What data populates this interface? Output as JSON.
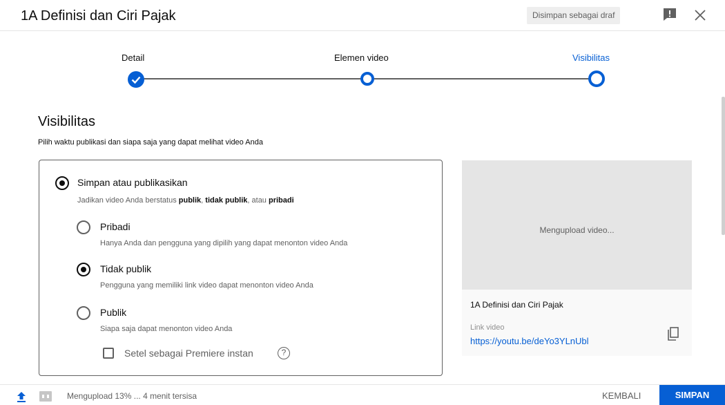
{
  "header": {
    "title": "1A Definisi dan Ciri Pajak",
    "draft_status": "Disimpan sebagai draf",
    "feedback_icon": "feedback-icon",
    "close_icon": "close-icon"
  },
  "stepper": {
    "steps": [
      {
        "label": "Detail",
        "state": "completed"
      },
      {
        "label": "Elemen video",
        "state": "upcoming"
      },
      {
        "label": "Visibilitas",
        "state": "active"
      }
    ],
    "active_color": "#065fd4",
    "completed_color": "#065fd4"
  },
  "visibility": {
    "title": "Visibilitas",
    "subtitle": "Pilih waktu publikasi dan siapa saja yang dapat melihat video Anda",
    "save_publish": {
      "label": "Simpan atau publikasikan",
      "desc_prefix": "Jadikan video Anda berstatus ",
      "desc_publik": "publik",
      "desc_sep1": ", ",
      "desc_tidak_publik": "tidak publik",
      "desc_sep2": ", atau ",
      "desc_pribadi": "pribadi",
      "selected": true
    },
    "options": [
      {
        "label": "Pribadi",
        "desc": "Hanya Anda dan pengguna yang dipilih yang dapat menonton video Anda",
        "selected": false
      },
      {
        "label": "Tidak publik",
        "desc": "Pengguna yang memiliki link video dapat menonton video Anda",
        "selected": true
      },
      {
        "label": "Publik",
        "desc": "Siapa saja dapat menonton video Anda",
        "selected": false
      }
    ],
    "premiere_label": "Setel sebagai Premiere instan",
    "premiere_checked": false
  },
  "preview": {
    "uploading_text": "Mengupload video...",
    "video_title": "1A Definisi dan Ciri Pajak",
    "link_label": "Link video",
    "link": "https://youtu.be/deYo3YLnUbl"
  },
  "footer": {
    "upload_status": "Mengupload 13% ... 4 menit tersisa",
    "upload_progress": 0.13,
    "back_label": "KEMBALI",
    "save_label": "SIMPAN"
  }
}
